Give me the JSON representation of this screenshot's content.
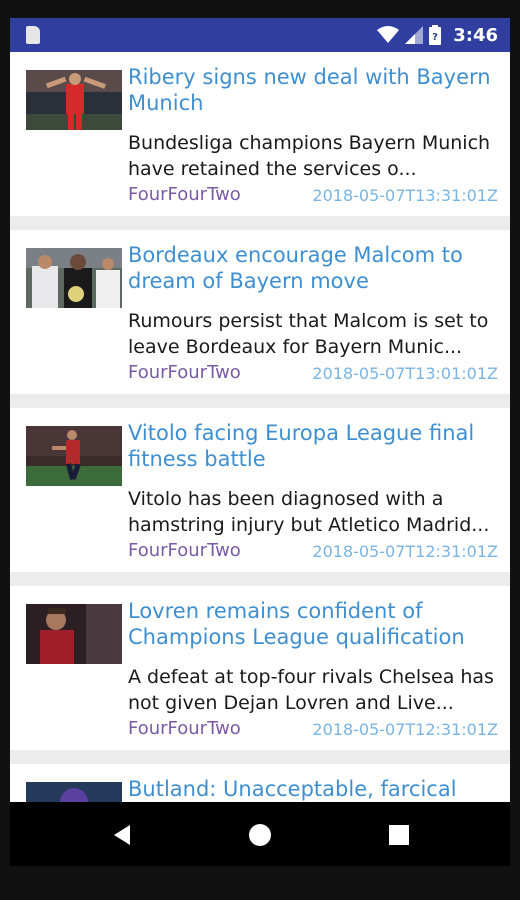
{
  "status_bar": {
    "time": "3:46"
  },
  "articles": [
    {
      "title": "Ribery signs new deal with Bayern Munich",
      "description": "Bundesliga champions Bayern Munich have retained the services o...",
      "source": "FourFourTwo",
      "date": "2018-05-07T13:31:01Z",
      "thumbnail": "player-celebrating-red-kit"
    },
    {
      "title": "Bordeaux encourage Malcom to dream of Bayern move",
      "description": "Rumours persist that Malcom is set to leave Bordeaux for Bayern Munic...",
      "source": "FourFourTwo",
      "date": "2018-05-07T13:01:01Z",
      "thumbnail": "players-contesting-ball"
    },
    {
      "title": "Vitolo facing Europa League final fitness battle",
      "description": "Vitolo has been diagnosed with a hamstring injury but Atletico Madrid...",
      "source": "FourFourTwo",
      "date": "2018-05-07T12:31:01Z",
      "thumbnail": "player-running-pitch"
    },
    {
      "title": "Lovren remains confident of Champions League qualification",
      "description": "A defeat at top-four rivals Chelsea has not given Dejan Lovren and Live...",
      "source": "FourFourTwo",
      "date": "2018-05-07T12:31:01Z",
      "thumbnail": "player-red-kit-portrait"
    },
    {
      "title": "Butland: Unacceptable, farcical",
      "description": "",
      "source": "",
      "date": "",
      "thumbnail": "player-purple-kit"
    }
  ],
  "navigation": {
    "back_icon": "back-triangle-icon",
    "home_icon": "home-circle-icon",
    "recents_icon": "recents-square-icon"
  },
  "colors": {
    "status_bar": "#303f9f",
    "title": "#3f8fd0",
    "source": "#7a5aa6",
    "date": "#7ab4e2"
  }
}
